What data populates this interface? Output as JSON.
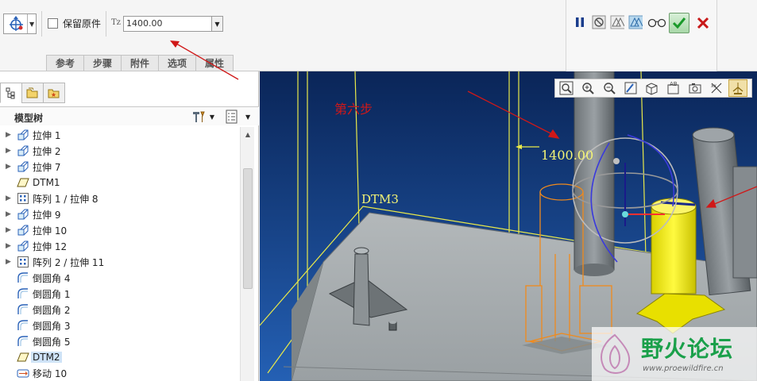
{
  "dashboard": {
    "keep_original_label": "保留原件",
    "tz_label": "Tz",
    "tz_value": "1400.00",
    "tabs": [
      "参考",
      "步骤",
      "附件",
      "选项",
      "属性"
    ]
  },
  "icons": {
    "drag_handle": "move-handle-icon",
    "pause": "pause-icon",
    "no_preview": "no-preview-icon",
    "preview": "preview-icon",
    "verify": "glasses-icon",
    "ok": "checkmark-icon",
    "cancel": "close-icon"
  },
  "panel": {
    "tree_title": "模型树",
    "tree": [
      {
        "label": "拉伸 1",
        "type": "extrude",
        "expandable": true
      },
      {
        "label": "拉伸 2",
        "type": "extrude",
        "expandable": true
      },
      {
        "label": "拉伸 7",
        "type": "extrude",
        "expandable": true
      },
      {
        "label": "DTM1",
        "type": "datum",
        "expandable": false
      },
      {
        "label": "阵列 1 / 拉伸 8",
        "type": "pattern",
        "expandable": true
      },
      {
        "label": "拉伸 9",
        "type": "extrude",
        "expandable": true
      },
      {
        "label": "拉伸 10",
        "type": "extrude",
        "expandable": true
      },
      {
        "label": "拉伸 12",
        "type": "extrude",
        "expandable": true
      },
      {
        "label": "阵列 2 / 拉伸 11",
        "type": "pattern",
        "expandable": true
      },
      {
        "label": "倒圆角 4",
        "type": "round",
        "expandable": false
      },
      {
        "label": "倒圆角 1",
        "type": "round",
        "expandable": false
      },
      {
        "label": "倒圆角 2",
        "type": "round",
        "expandable": false
      },
      {
        "label": "倒圆角 3",
        "type": "round",
        "expandable": false
      },
      {
        "label": "倒圆角 5",
        "type": "round",
        "expandable": false
      },
      {
        "label": "DTM2",
        "type": "datum",
        "expandable": false,
        "selected": true
      },
      {
        "label": "移动 10",
        "type": "move",
        "expandable": false
      }
    ]
  },
  "viewport": {
    "annotation": "第六步",
    "dimension": "1400.00",
    "datum_label": "DTM3",
    "watermark_title": "野火论坛",
    "watermark_url": "www.proewildfire.cn",
    "colors": {
      "background_top": "#0b2a66",
      "background_bottom": "#1f56a8",
      "part_gray": "#a6acae",
      "highlight_yellow": "#f5f000",
      "preview_orange": "#f08a1c",
      "annotation_red": "#d01818"
    }
  }
}
